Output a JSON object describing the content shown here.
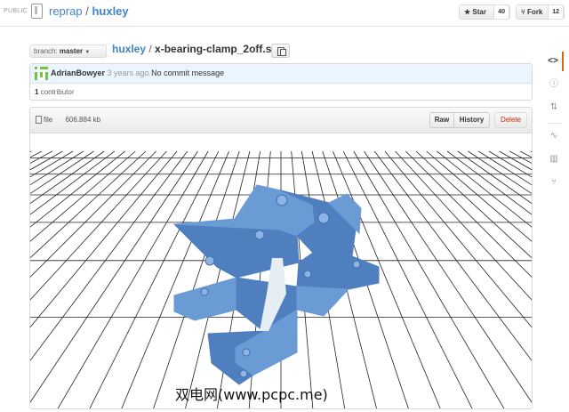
{
  "header": {
    "visibility": "PUBLIC",
    "owner": "reprap",
    "separator": "/",
    "repo": "huxley",
    "star_label": "★ Star",
    "star_count": "40",
    "fork_label": "⑂ Fork",
    "fork_count": "12"
  },
  "file_nav": {
    "branch_label": "branch:",
    "branch_value": "master",
    "repo": "huxley",
    "separator": "/",
    "file_name": "x-bearing-clamp_2off.stl"
  },
  "commit": {
    "author": "AdrianBowyer",
    "time": "3 years ago",
    "message": "No commit message",
    "contributors_count": "1",
    "contributors_label": "contributor"
  },
  "file": {
    "kind": "file",
    "size": "606.884 kb",
    "raw_label": "Raw",
    "history_label": "History",
    "delete_label": "Delete"
  },
  "viewer": {
    "model_color": "#6b9bd4",
    "model_dark": "#4f7fbf",
    "model_light": "#8db4e4"
  },
  "watermark": "双电网(www.pcpc.me)",
  "side_nav": {
    "icons": [
      "code-icon",
      "issues-icon",
      "pull-request-icon",
      "pulse-icon",
      "graphs-icon",
      "branch-icon"
    ],
    "active": "code-icon"
  }
}
